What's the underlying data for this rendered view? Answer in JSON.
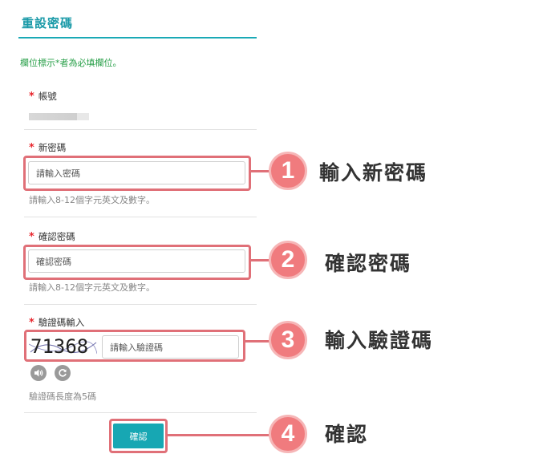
{
  "form": {
    "title": "重設密碼",
    "required_note": "欄位標示*者為必填欄位。",
    "account": {
      "label": "帳號"
    },
    "new_password": {
      "label": "新密碼",
      "placeholder": "請輸入密碼",
      "hint": "請輸入8-12個字元英文及數字。"
    },
    "confirm_password": {
      "label": "確認密碼",
      "placeholder": "確認密碼",
      "hint": "請輸入8-12個字元英文及數字。"
    },
    "captcha": {
      "label": "驗證碼輸入",
      "image_text": "71368",
      "placeholder": "請輸入驗證碼",
      "hint": "驗證碼長度為5碼"
    },
    "submit_label": "確認",
    "required_mark": "*"
  },
  "steps": [
    {
      "number": "1",
      "text": "輸入新密碼"
    },
    {
      "number": "2",
      "text": "確認密碼"
    },
    {
      "number": "3",
      "text": "輸入驗證碼"
    },
    {
      "number": "4",
      "text": "確認"
    }
  ],
  "colors": {
    "accent": "#1aa9b6",
    "highlight": "#e07078",
    "badge": "#f07b7e",
    "required": "#e8262d",
    "note": "#2aa04a"
  },
  "icons": {
    "audio": "speaker-icon",
    "refresh": "refresh-icon"
  }
}
